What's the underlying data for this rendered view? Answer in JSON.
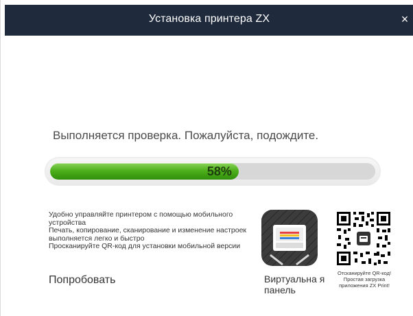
{
  "window": {
    "title": "Установка принтера ZX",
    "close_glyph": "×"
  },
  "status": {
    "message": "Выполняется проверка. Пожалуйста, подождите.",
    "progress_percent": 58,
    "progress_label": "58%",
    "progress_color": "#4fb01c"
  },
  "mobile_info": {
    "lines": [
      "Удобно управляйте принтером с помощью мобильного устройства",
      "Печать, копирование, сканирование и изменение настроек выполняется легко и быстро",
      "Просканируйте QR-код для установки мобильной версии"
    ],
    "try_label": "Попробовать"
  },
  "virtual_panel": {
    "icon": "printer-app-icon",
    "label": "Виртуальна я панель"
  },
  "qr": {
    "icon": "qr-code-icon",
    "caption_lines": [
      "Отсканируйте QR-код!",
      "Простая загрузка",
      "приложения ZX Print!"
    ]
  }
}
